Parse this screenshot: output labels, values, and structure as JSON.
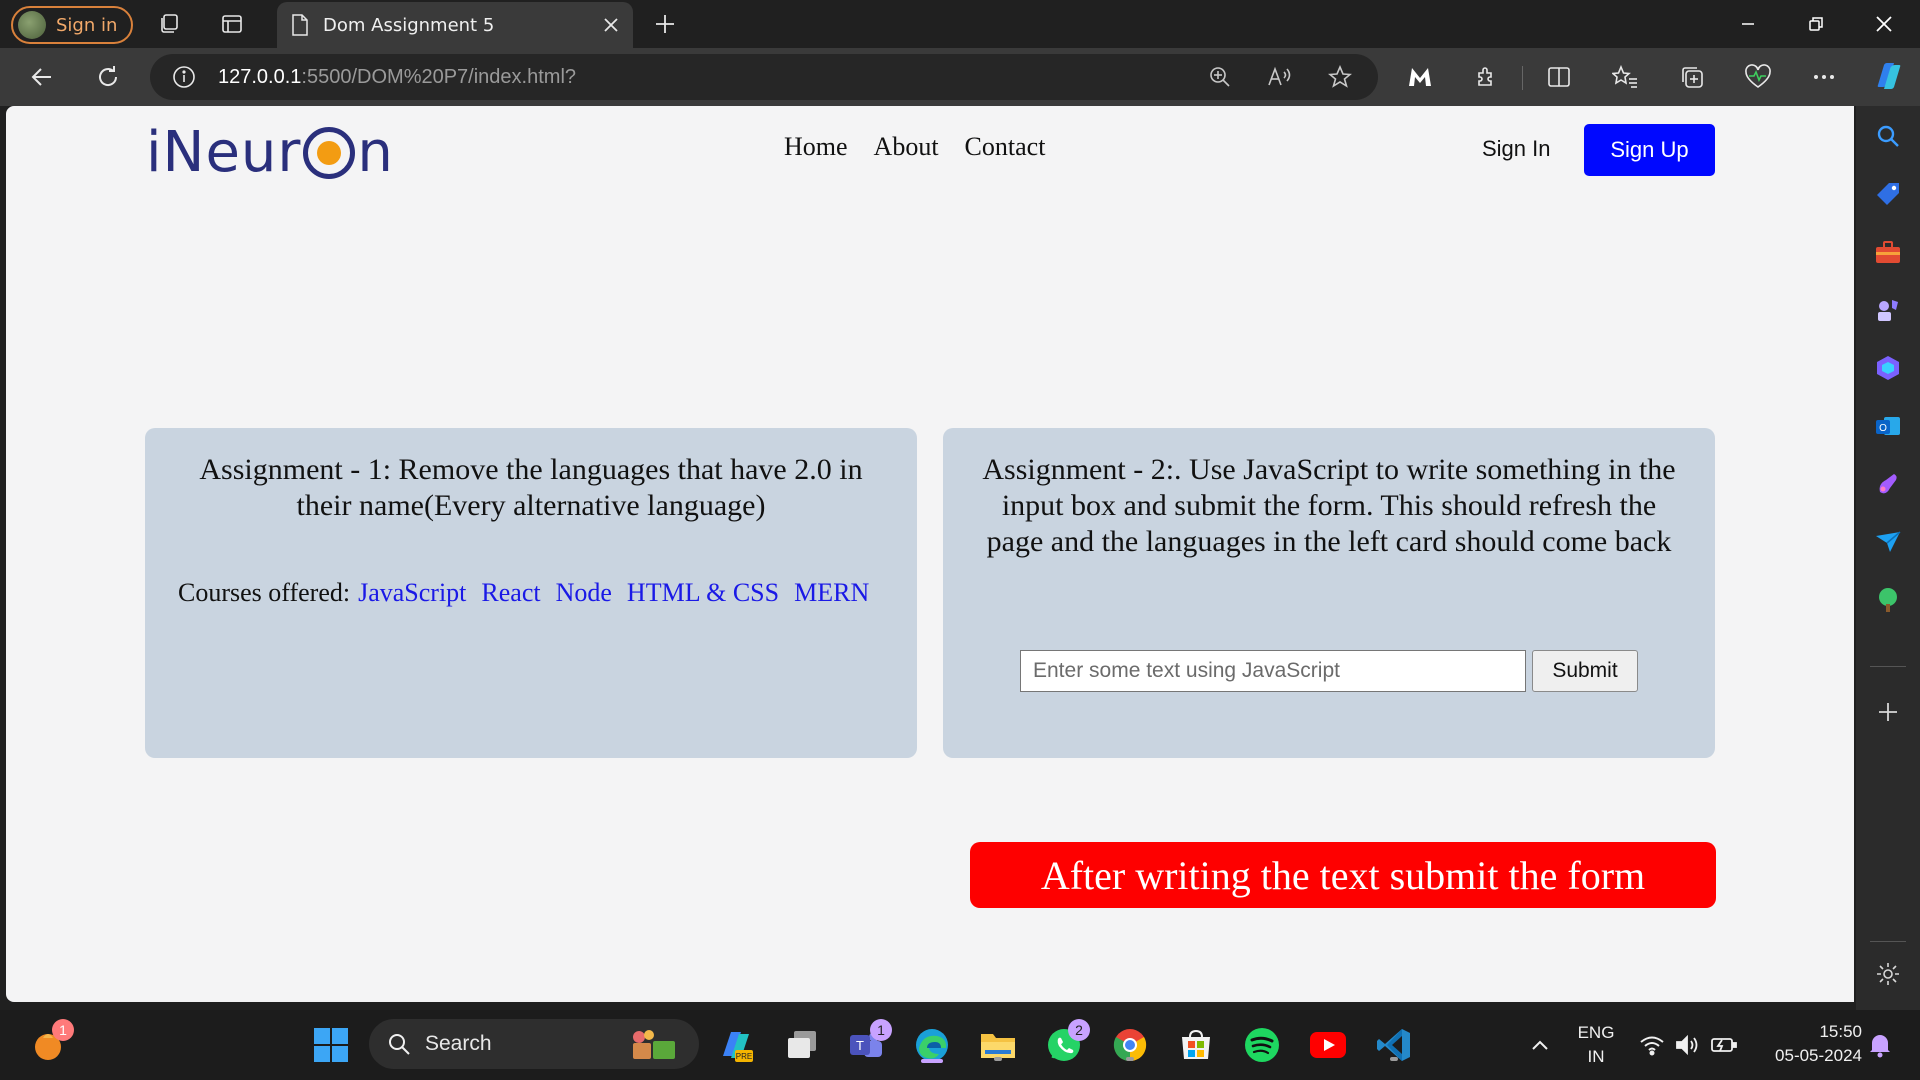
{
  "browser": {
    "profile_label": "Sign in",
    "tab_title": "Dom Assignment 5",
    "url_host": "127.0.0.1",
    "url_rest": ":5500/DOM%20P7/index.html?"
  },
  "header": {
    "logo_prefix": "iNeur",
    "logo_suffix": "n",
    "nav": [
      "Home",
      "About",
      "Contact"
    ],
    "signin": "Sign In",
    "signup": "Sign Up"
  },
  "card1": {
    "title": "Assignment - 1: Remove the languages that have 2.0 in their name(Every alternative language)",
    "courses_label": "Courses offered:",
    "languages": [
      "JavaScript",
      "React",
      "Node",
      "HTML & CSS",
      "MERN"
    ]
  },
  "card2": {
    "title": "Assignment - 2:. Use JavaScript to write something in the input box and submit the form. This should refresh the page and the languages in the left card should come back",
    "input_placeholder": "Enter some text using JavaScript",
    "submit_label": "Submit"
  },
  "banner": {
    "text": "After writing the text submit the form"
  },
  "taskbar": {
    "search_label": "Search",
    "notif_badge": "1",
    "teams_badge": "1",
    "whatsapp_badge": "2",
    "lang_top": "ENG",
    "lang_bottom": "IN",
    "time": "15:50",
    "date": "05-05-2024"
  },
  "colors": {
    "signup_bg": "#0008ff",
    "card_bg": "#c9d4e0",
    "banner_bg": "#fe0000",
    "link": "#1a19e6",
    "logo": "#2a2f7c"
  }
}
